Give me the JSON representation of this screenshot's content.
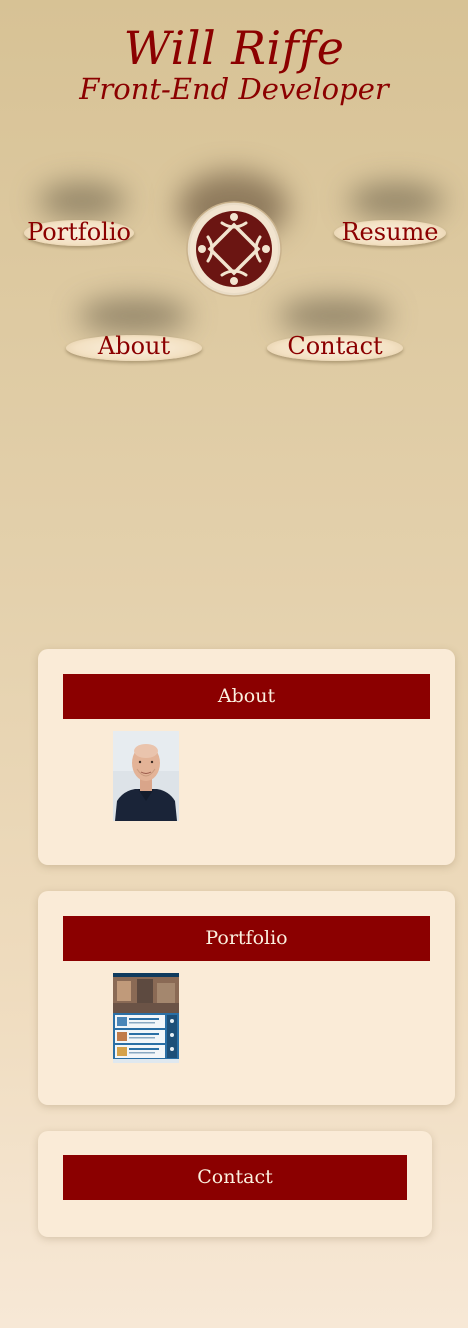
{
  "header": {
    "name": "Will Riffe",
    "title": "Front-End Developer"
  },
  "nav": {
    "portfolio": "Portfolio",
    "resume": "Resume",
    "about": "About",
    "contact": "Contact"
  },
  "logo": {
    "icon": "diamond-emblem-icon"
  },
  "sections": {
    "about": {
      "heading": "About",
      "image": "portrait-photo"
    },
    "portfolio": {
      "heading": "Portfolio",
      "image": "website-screenshot-thumbnail"
    },
    "contact": {
      "heading": "Contact"
    }
  },
  "colors": {
    "accent": "#8b0000",
    "card": "#faebd7",
    "background_top": "#d7c295",
    "background_bottom": "#f7e8d6"
  }
}
